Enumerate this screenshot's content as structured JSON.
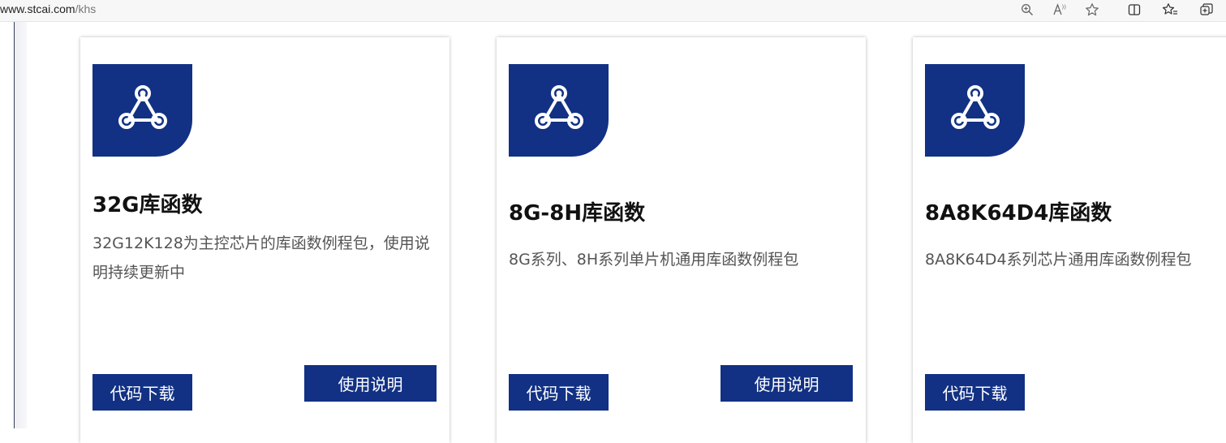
{
  "browser": {
    "url_host": "www.stcai.com",
    "url_path": "/khs",
    "toolbar_icons": [
      "zoom-icon",
      "read-aloud-icon",
      "favorite-icon",
      "split-screen-icon",
      "favorites-list-icon",
      "collections-icon"
    ]
  },
  "cards": [
    {
      "title": "32G库函数",
      "description": "32G12K128为主控芯片的库函数例程包，使用说明持续更新中",
      "download_label": "代码下载",
      "manual_label": "使用说明"
    },
    {
      "title": "8G-8H库函数",
      "description": "8G系列、8H系列单片机通用库函数例程包",
      "download_label": "代码下载",
      "manual_label": "使用说明"
    },
    {
      "title": "8A8K64D4库函数",
      "description": "8A8K64D4系列芯片通用库函数例程包",
      "download_label": "代码下载"
    }
  ],
  "colors": {
    "brand_blue": "#123184"
  }
}
